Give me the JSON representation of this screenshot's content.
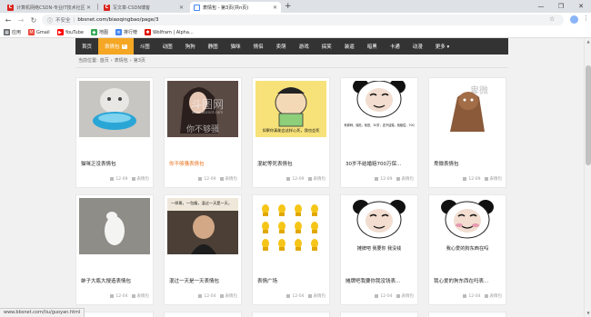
{
  "browser": {
    "tabs": [
      {
        "title": "计算机网络CSDN-专业IT技术社区",
        "fav_color": "#d9251d",
        "fav_letter": "C",
        "active": false
      },
      {
        "title": "写文章-CSDN博客",
        "fav_color": "#d9251d",
        "fav_letter": "C",
        "active": false
      },
      {
        "title": "表情包 - 第3页(共n页)",
        "fav_color": "#e0e0e0",
        "fav_letter": "",
        "active": true
      }
    ],
    "new_tab": "+",
    "window_controls": [
      "—",
      "❐",
      "✕"
    ],
    "nav": {
      "back": "←",
      "forward": "→",
      "reload": "↻"
    },
    "omnibox": {
      "info_icon": "ⓘ",
      "security": "不安全",
      "separator": "|",
      "url": "bbsnet.com/biaoqingbao/page/3"
    },
    "bookmarks": [
      {
        "label": "应用",
        "icon": "apps-icon",
        "color": "#5f6368"
      },
      {
        "label": "Gmail",
        "icon": "gmail-icon",
        "color": "#ea4335"
      },
      {
        "label": "YouTube",
        "icon": "youtube-icon",
        "color": "#ff0000"
      },
      {
        "label": "地图",
        "icon": "maps-icon",
        "color": "#34a853"
      },
      {
        "label": "排行榜",
        "icon": "ranking-icon",
        "color": "#4285f4"
      },
      {
        "label": "Wolfram | Alpha...",
        "icon": "wolfram-icon",
        "color": "#dd1100"
      }
    ]
  },
  "site": {
    "nav": [
      {
        "label": "首页",
        "active": false
      },
      {
        "label": "表情包",
        "active": true,
        "badge": "④"
      },
      {
        "label": "斗图",
        "active": false
      },
      {
        "label": "动图",
        "active": false
      },
      {
        "label": "狗狗",
        "active": false
      },
      {
        "label": "静图",
        "active": false
      },
      {
        "label": "猫咪",
        "active": false
      },
      {
        "label": "情侣",
        "active": false
      },
      {
        "label": "卖萌",
        "active": false
      },
      {
        "label": "游戏",
        "active": false
      },
      {
        "label": "搞笑",
        "active": false
      },
      {
        "label": "装逼",
        "active": false
      },
      {
        "label": "暗黑",
        "active": false
      },
      {
        "label": "卡通",
        "active": false
      },
      {
        "label": "动漫",
        "active": false
      },
      {
        "label": "更多 ▾",
        "active": false
      }
    ],
    "breadcrumb": [
      "当前位置:",
      "首页",
      "›",
      "表情包",
      "›",
      "第3页"
    ],
    "cards": [
      {
        "title": "猫咪乏没表情包",
        "date": "12-09",
        "tag": "表情包",
        "highlight": false,
        "art": "cat-bath"
      },
      {
        "title": "你不够骚表情包",
        "date": "12-09",
        "tag": "表情包",
        "highlight": true,
        "art": "girl-photo"
      },
      {
        "title": "混蛇等死表情包",
        "date": "12-09",
        "tag": "表情包",
        "highlight": false,
        "art": "cartoon-boy"
      },
      {
        "title": "30岁不结婚赔700万保...",
        "date": "12-09",
        "tag": "表情包",
        "highlight": false,
        "art": "panda-text"
      },
      {
        "title": "卑微表情包",
        "date": "12-09",
        "tag": "表情包",
        "highlight": false,
        "art": "bear-humble"
      },
      {
        "title": "蚌子大瓶大搜造表情包",
        "date": "12-04",
        "tag": "表情包",
        "highlight": false,
        "art": "white-animal"
      },
      {
        "title": "混过一天是一天表情包",
        "date": "12-04",
        "tag": "表情包",
        "highlight": false,
        "art": "man-office"
      },
      {
        "title": "表情广场",
        "date": "12-04",
        "tag": "表情包",
        "highlight": false,
        "art": "yellow-grid"
      },
      {
        "title": "摊牌吧我要你我没钱表...",
        "date": "12-04",
        "tag": "表情包",
        "highlight": false,
        "art": "panda-money"
      },
      {
        "title": "我心爱的狗东西在吗表...",
        "date": "12-04",
        "tag": "表情包",
        "highlight": false,
        "art": "panda-dog"
      }
    ],
    "art_text": {
      "bear-humble": "卑微",
      "girl-photo-top": "斗图网",
      "girl-photo-url": "www.bbsnet.com",
      "girl-photo-bottom": "你不够骚",
      "cartoon-boy": "如果你真能会这样心死，我也会死",
      "panda-text": "那个，有没有那种，保险，就是，30岁，还不结婚，就赔偿，700万，的那种",
      "man-office": "一样哥，一包烟，混过一天是一天，",
      "panda-money": "摊牌吧 我要你 我没钱",
      "panda-dog": "我心爱的狗东西在吗"
    }
  },
  "status": "www.bbsnet.com/tiu/guoyan.html",
  "colors": {
    "nav_bg": "#333333",
    "nav_active": "#f5a623",
    "title_highlight": "#e8741e"
  }
}
